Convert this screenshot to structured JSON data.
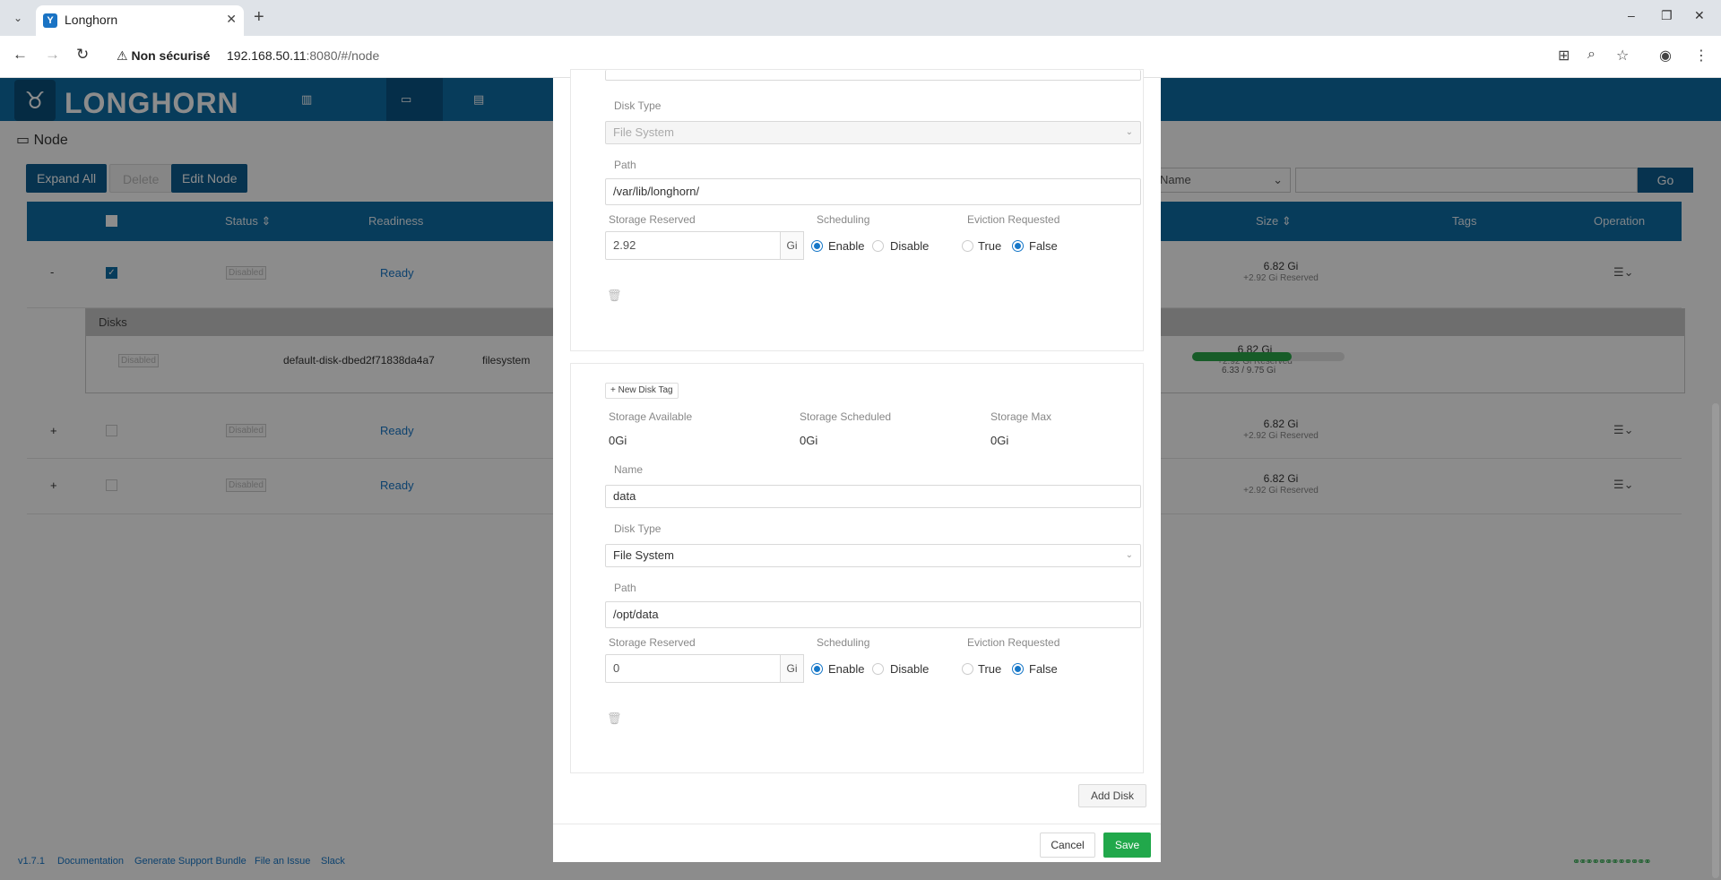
{
  "browser": {
    "tab_title": "Longhorn",
    "security_label": "Non sécurisé",
    "url_host": "192.168.50.11",
    "url_rest": ":8080/#/node"
  },
  "app": {
    "logo_text": "LONGHORN",
    "nav": [
      {
        "label": "Dashboard"
      },
      {
        "label": "Node"
      },
      {
        "label": "Volume"
      }
    ],
    "page_title": "Node",
    "buttons": {
      "expand_all": "Expand All",
      "delete": "Delete",
      "edit_node": "Edit Node",
      "go": "Go"
    },
    "search_field": "Name",
    "columns": {
      "status": "Status",
      "readiness": "Readiness",
      "size": "Size",
      "tags": "Tags",
      "operation": "Operation"
    },
    "rows": [
      {
        "toggle": "-",
        "status": "Disabled",
        "readiness": "Ready",
        "size": "6.82 Gi",
        "reserved": "+2.92 Gi Reserved"
      },
      {
        "toggle": "+",
        "status": "Disabled",
        "readiness": "Ready",
        "size": "6.82 Gi",
        "reserved": "+2.92 Gi Reserved"
      },
      {
        "toggle": "+",
        "status": "Disabled",
        "readiness": "Ready",
        "size": "6.82 Gi",
        "reserved": "+2.92 Gi Reserved"
      }
    ],
    "disks": {
      "header": "Disks",
      "status": "Disabled",
      "name": "default-disk-dbed2f71838da4a7",
      "type": "filesystem",
      "usage_label": "6.33 / 9.75 Gi",
      "usage_fraction": 0.65,
      "size": "6.82 Gi",
      "reserved": "+2.92 Gi Reserved"
    },
    "footer": [
      "v1.7.1",
      "Documentation",
      "Generate Support Bundle",
      "File an Issue",
      "Slack"
    ]
  },
  "modal": {
    "disk1": {
      "disk_type_label": "Disk Type",
      "disk_type": "File System",
      "path_label": "Path",
      "path": "/var/lib/longhorn/",
      "storage_reserved_label": "Storage Reserved",
      "storage_reserved": "2.92",
      "unit": "Gi",
      "scheduling_label": "Scheduling",
      "enable": "Enable",
      "disable": "Disable",
      "eviction_label": "Eviction Requested",
      "true_label": "True",
      "false_label": "False"
    },
    "disk2": {
      "new_tag": "New Disk Tag",
      "storage_available_label": "Storage Available",
      "storage_available": "0Gi",
      "storage_scheduled_label": "Storage Scheduled",
      "storage_scheduled": "0Gi",
      "storage_max_label": "Storage Max",
      "storage_max": "0Gi",
      "name_label": "Name",
      "name": "data",
      "disk_type_label": "Disk Type",
      "disk_type": "File System",
      "path_label": "Path",
      "path": "/opt/data",
      "storage_reserved_label": "Storage Reserved",
      "storage_reserved": "0",
      "unit": "Gi",
      "scheduling_label": "Scheduling",
      "enable": "Enable",
      "disable": "Disable",
      "eviction_label": "Eviction Requested",
      "true_label": "True",
      "false_label": "False"
    },
    "add_disk": "Add Disk",
    "cancel": "Cancel",
    "save": "Save"
  },
  "colors": {
    "header_blue": "#0e6ea6",
    "save_green": "#21a84b",
    "link_blue": "#1677c8"
  }
}
